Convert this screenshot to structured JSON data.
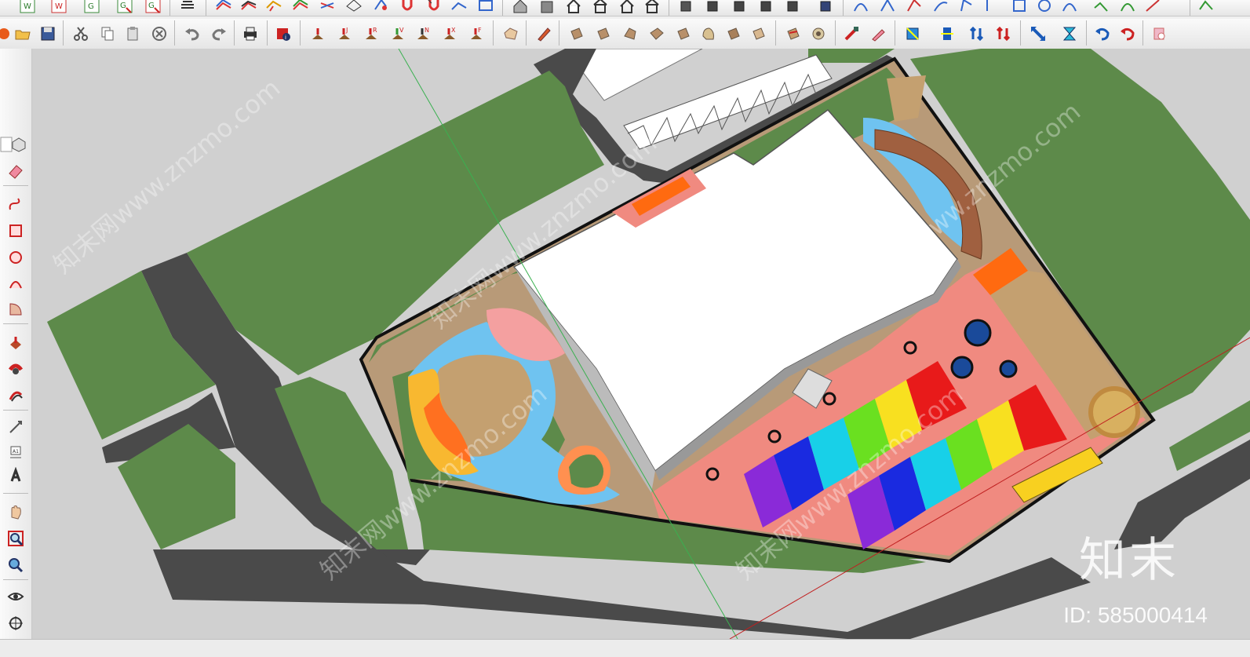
{
  "watermark": {
    "logo_text": "知末",
    "id_text": "ID: 585000414",
    "diagonal_text": "知末网www.znzmo.com"
  },
  "colors": {
    "ground": "#d0d0d0",
    "road": "#4a4a4a",
    "grass": "#5d8a4a",
    "building": "#ffffff",
    "pink_plaza": "#f08a80",
    "water": "#6fc3f0",
    "sand": "#c4a070",
    "orange": "#ff6a10"
  },
  "top_toolbar_icons": [
    "layer-w-icon",
    "layer-w-red-icon",
    "layer-g-icon",
    "layer-g-arrow-icon",
    "layer-g-red-icon",
    "stack-icon",
    "surface-1-icon",
    "surface-2-icon",
    "surface-3-icon",
    "surface-4-icon",
    "surface-5-icon",
    "surface-6-icon",
    "surface-7-icon",
    "magnet-icon",
    "magnet-2-icon",
    "surface-8-icon",
    "frame-icon",
    "house-tool-1-icon",
    "house-tool-2-icon",
    "house-icon",
    "house-2-icon",
    "house-3-icon",
    "house-4-icon",
    "box-tool-1-icon",
    "box-tool-2-icon",
    "box-tool-3-icon",
    "box-tool-4-icon",
    "box-tool-5-icon",
    "curve-1-icon",
    "curve-2-icon",
    "curve-3-icon",
    "curve-4-icon",
    "curve-5-icon",
    "curve-6-icon",
    "curve-7-icon",
    "curve-8-icon",
    "curve-9-icon",
    "curve-10-icon"
  ],
  "main_toolbar_icons": [
    "new-file-icon",
    "open-folder-icon",
    "save-icon",
    "cut-icon",
    "copy-icon",
    "paste-icon",
    "delete-icon",
    "undo-icon",
    "redo-icon",
    "print-icon",
    "model-info-icon",
    "axis-icon",
    "axis-j-icon",
    "axis-r-icon",
    "axis-v-icon",
    "axis-n-icon",
    "axis-x-icon",
    "axis-f-icon",
    "shape-1-icon",
    "pencil-icon",
    "face-1-icon",
    "face-2-icon",
    "face-3-icon",
    "face-4-icon",
    "face-5-icon",
    "face-6-icon",
    "face-7-icon",
    "face-8-icon",
    "sketch-1-icon",
    "sketch-2-icon",
    "paint-1-icon",
    "paint-2-icon",
    "box-blue-icon",
    "flip-icon",
    "arrows-up-icon",
    "arrows-down-icon",
    "scale-icon",
    "hourglass-icon",
    "rotate-icon",
    "rotate-2-icon",
    "eraser-pink-icon"
  ],
  "left_toolbar_icons": [
    "select-icon",
    "component-icon",
    "eraser-icon",
    "freehand-icon",
    "rectangle-icon",
    "circle-icon",
    "arc-icon",
    "pie-icon",
    "push-pull-icon",
    "follow-me-icon",
    "offset-icon",
    "tape-measure-icon",
    "dimension-icon",
    "text-icon",
    "3d-text-icon",
    "orbit-icon",
    "pan-icon",
    "zoom-icon",
    "zoom-window-icon",
    "walk-icon",
    "look-around-icon",
    "position-camera-icon"
  ]
}
